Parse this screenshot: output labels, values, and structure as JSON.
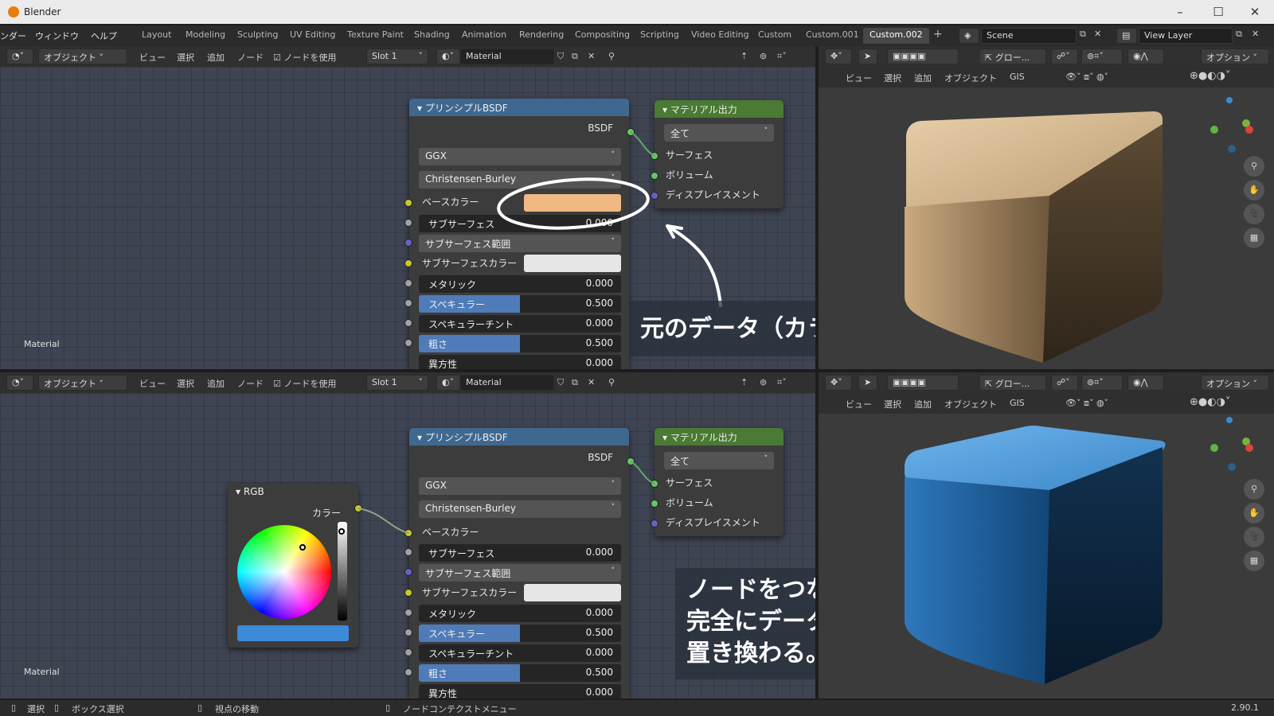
{
  "app": {
    "title": "Blender",
    "version": "2.90.1"
  },
  "menu": [
    "ンダー",
    "ウィンドウ",
    "ヘルプ"
  ],
  "workspaces": [
    "Layout",
    "Modeling",
    "Sculpting",
    "UV Editing",
    "Texture Paint",
    "Shading",
    "Animation",
    "Rendering",
    "Compositing",
    "Scripting",
    "Video Editing",
    "Custom",
    "Custom.001",
    "Custom.002"
  ],
  "add_tab": "+",
  "scene": "Scene",
  "view_layer": "View Layer",
  "node_header": {
    "mode": "オブジェクト",
    "view": "ビュー",
    "select": "選択",
    "add": "追加",
    "node": "ノード",
    "use_nodes": "ノードを使用",
    "slot": "Slot 1",
    "material": "Material"
  },
  "viewport_header": {
    "view": "ビュー",
    "select": "選択",
    "add": "追加",
    "object": "オブジェクト",
    "gis": "GIS",
    "options": "オプション",
    "transform": "グロー..."
  },
  "editor_label": "Material",
  "bsdf": {
    "title": "プリンシプルBSDF",
    "out": "BSDF",
    "dist": "GGX",
    "sss_method": "Christensen-Burley",
    "base_color": "ベースカラー",
    "subsurface": "サブサーフェス",
    "subsurface_val": "0.000",
    "sss_radius": "サブサーフェス範囲",
    "sss_color": "サブサーフェスカラー",
    "metallic": "メタリック",
    "metallic_val": "0.000",
    "specular": "スペキュラー",
    "specular_val": "0.500",
    "spec_tint": "スペキュラーチント",
    "spec_tint_val": "0.000",
    "roughness": "粗さ",
    "roughness_val": "0.500",
    "aniso": "異方性",
    "aniso_val": "0.000"
  },
  "output": {
    "title": "マテリアル出力",
    "target": "全て",
    "surface": "サーフェス",
    "volume": "ボリューム",
    "displacement": "ディスプレイスメント"
  },
  "rgb": {
    "title": "RGB",
    "out": "カラー"
  },
  "colors": {
    "base_orange": "#f0b883",
    "cube_tan": "#d6b98e",
    "cube_blue": "#3a86c8",
    "rgb_blue": "#3d8ad9",
    "sss_white": "#e6e6e6"
  },
  "annotations": {
    "top": "元のデータ（カラー）。",
    "bottom_line1": "ノードをつなぐと",
    "bottom_line2": "完全にデータが",
    "bottom_line3": "置き換わる。"
  },
  "status": {
    "select": "選択",
    "box_select": "ボックス選択",
    "move_view": "視点の移動",
    "ctx_menu": "ノードコンテクストメニュー"
  }
}
